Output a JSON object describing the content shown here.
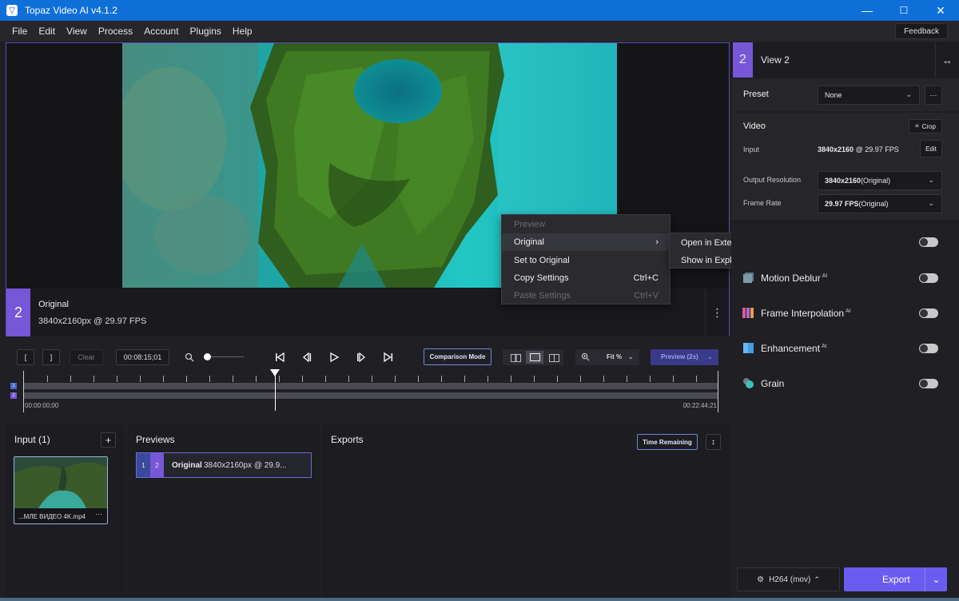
{
  "window": {
    "title": "Topaz Video AI  v4.1.2",
    "min": "—",
    "max": "☐",
    "close": "✕"
  },
  "menu": [
    "File",
    "Edit",
    "View",
    "Process",
    "Account",
    "Plugins",
    "Help"
  ],
  "feedback_label": "Feedback",
  "viewer": {
    "view_number": "2",
    "name": "Original",
    "meta": "3840x2160px @ 29.97 FPS"
  },
  "context_menu": {
    "items": [
      {
        "label": "Preview",
        "shortcut": "",
        "disabled": true
      },
      {
        "label": "Original",
        "shortcut": "",
        "disabled": false
      },
      {
        "label": "Set to Original",
        "shortcut": "",
        "disabled": false
      },
      {
        "label": "Copy Settings",
        "shortcut": "Ctrl+C",
        "disabled": false
      },
      {
        "label": "Paste Settings",
        "shortcut": "Ctrl+V",
        "disabled": true
      }
    ],
    "submenu": [
      "Open in External Player",
      "Show in Explorer"
    ]
  },
  "transport": {
    "in_label": "[",
    "out_label": "]",
    "clear_label": "Clear",
    "timecode": "00:08:15;01",
    "comparison_label": "Comparison Mode",
    "zoom_label": "Fit %",
    "preview_label": "Preview (2s)"
  },
  "timeline": {
    "start": "00:00:00;00",
    "end": "00:22:44;21",
    "track1": "1",
    "track2": "2",
    "playhead_fraction": 0.362
  },
  "input_panel": {
    "title": "Input (1)",
    "add": "+",
    "file_name": "...МЛЕ ВИДЕО 4K.mp4",
    "file_menu": "···"
  },
  "previews_panel": {
    "title": "Previews",
    "item_n1": "1",
    "item_n2": "2",
    "item_name": "Original",
    "item_meta": "3840x2160px @ 29.9..."
  },
  "exports_panel": {
    "title": "Exports",
    "time_remaining": "Time Remaining",
    "sort": "↕"
  },
  "sidebar": {
    "view_number": "2",
    "view_title": "View 2",
    "preset_label": "Preset",
    "preset_value": "None",
    "preset_more": "···",
    "video_label": "Video",
    "crop_label": "Crop",
    "input_label": "Input",
    "input_res": "3840x2160",
    "input_fps": " @ 29.97 FPS",
    "edit_label": "Edit",
    "output_res_label": "Output Resolution",
    "output_res_value": "3840x2160",
    "output_res_suffix": " (Original)",
    "frame_rate_label": "Frame Rate",
    "frame_rate_value": "29.97 FPS",
    "frame_rate_suffix": " (Original)",
    "features": [
      {
        "label": "Motion Deblur",
        "ai": "AI",
        "color": "#6a8a9a",
        "enabled": false
      },
      {
        "label": "Frame Interpolation",
        "ai": "AI",
        "color": "#b06ad0",
        "enabled": false
      },
      {
        "label": "Enhancement",
        "ai": "AI",
        "color": "#4a9ae0",
        "enabled": false
      },
      {
        "label": "Grain",
        "ai": "",
        "color": "#4ab0b0",
        "enabled": false
      }
    ],
    "codec_label": "H264 (mov)",
    "export_label": "Export"
  },
  "colors": {
    "accent": "#7856d8",
    "export": "#6a5cf0",
    "titlebar": "#0f6fd9"
  }
}
